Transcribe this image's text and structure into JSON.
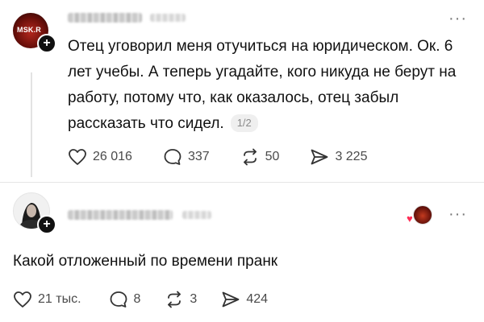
{
  "post1": {
    "avatar_label": "MSK.R",
    "follow_symbol": "+",
    "text": "Отец уговорил меня отучиться на юридическом. Ок. 6 лет учебы. А теперь угадайте, кого никуда не берут на работу, потому что, как оказалось, отец забыл рассказать что сидел.",
    "page_indicator": "1/2",
    "more": "···",
    "actions": {
      "likes": "26 016",
      "comments": "337",
      "reposts": "50",
      "shares": "3 225"
    }
  },
  "post2": {
    "follow_symbol": "+",
    "text": "Какой отложенный по времени пранк",
    "more": "···",
    "actions": {
      "likes": "21 тыс.",
      "comments": "8",
      "reposts": "3",
      "shares": "424"
    }
  },
  "icons": {
    "like": "heart-icon",
    "comment": "comment-bubble-icon",
    "repost": "repost-icon",
    "share": "send-icon",
    "more": "more-icon"
  },
  "colors": {
    "text": "#111111",
    "muted": "#4a4a4a",
    "accent_heart": "#ff2d55"
  }
}
